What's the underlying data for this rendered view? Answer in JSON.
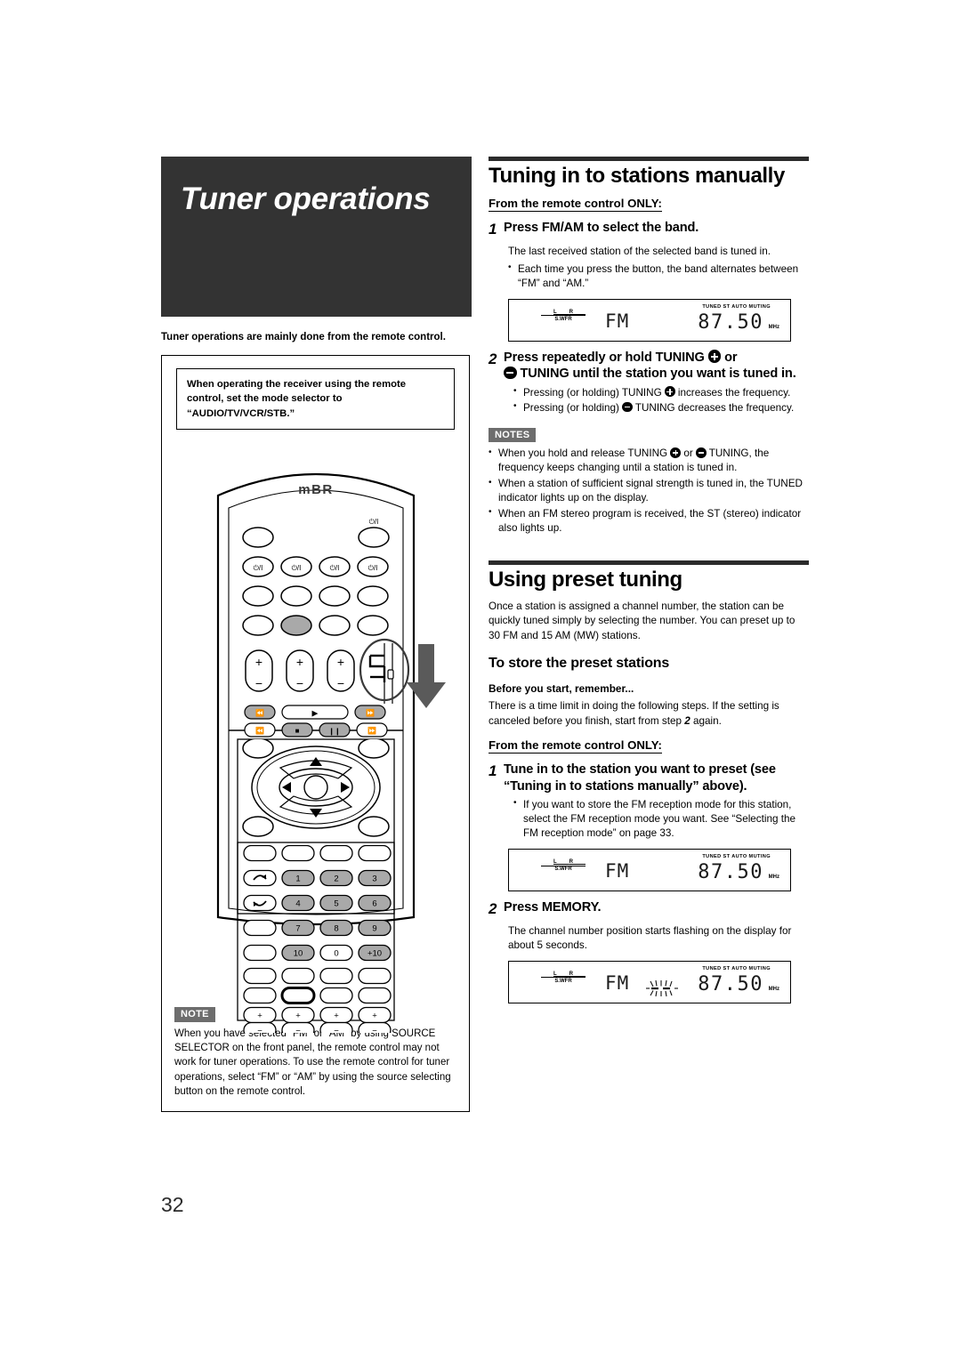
{
  "page": {
    "number": "32",
    "title": "Tuner operations",
    "intro": "Tuner operations are mainly done from the remote control.",
    "mode_note": "When operating the receiver using the remote control, set the mode selector to “AUDIO/TV/VCR/STB.”"
  },
  "remote": {
    "brand": "mBR",
    "power_symbol": "⏻/I",
    "keys": {
      "row_123": [
        "1",
        "2",
        "3"
      ],
      "row_456": [
        "4",
        "5",
        "6"
      ],
      "row_789": [
        "7",
        "8",
        "9"
      ],
      "row_10_0_plus10": [
        "10",
        "0",
        "+10"
      ]
    },
    "transport": {
      "prev": "⏮",
      "play": "▶",
      "next": "⏭",
      "rew": "⏪",
      "stop": "■",
      "pause": "❙❙",
      "ff": "⏩"
    },
    "cursor": {
      "up": "▲",
      "down": "▼",
      "left": "◀",
      "right": "▶"
    },
    "volume": {
      "plus": "+",
      "minus": "−"
    }
  },
  "note_left": {
    "label": "NOTE",
    "text": "When you have selected “FM” or “AM” by using SOURCE SELECTOR on the front panel, the remote control may not work for tuner operations. To use the remote control for tuner operations, select “FM” or “AM” by using the source selecting button on the remote control."
  },
  "section1": {
    "heading": "Tuning in to stations manually",
    "from_remote": "From the remote control ONLY:",
    "step1": {
      "num": "1",
      "title": "Press FM/AM to select the band.",
      "body": "The last received station of the selected band is tuned in.",
      "bullets": [
        "Each time you press the button, the band alternates between “FM” and “AM.”"
      ]
    },
    "step2": {
      "num": "2",
      "title_a": "Press repeatedly or hold TUNING",
      "title_b": "or",
      "title_c": "TUNING until the station you want is tuned in.",
      "bullets": [
        {
          "pre": "Pressing (or holding) TUNING",
          "icon": "plus",
          "post": "increases the frequency."
        },
        {
          "pre": "Pressing (or holding)",
          "icon": "minus",
          "post": "TUNING decreases the frequency."
        }
      ]
    },
    "notes": {
      "label": "NOTES",
      "items": [
        {
          "pre": "When you hold and release TUNING",
          "icon1": "plus",
          "mid": "or",
          "icon2": "minus",
          "post": "TUNING, the frequency keeps changing until a station is tuned in."
        },
        {
          "text": "When a station of sufficient signal strength is tuned in, the TUNED indicator lights up on the display."
        },
        {
          "text": "When an FM stereo program is received, the ST (stereo) indicator also lights up."
        }
      ]
    }
  },
  "section2": {
    "heading": "Using preset tuning",
    "intro": "Once a station is assigned a channel number, the station can be quickly tuned simply by selecting the number. You can preset up to 30 FM and 15 AM (MW) stations.",
    "sub_heading": "To store the preset stations",
    "before_label": "Before you start, remember...",
    "before_text_a": "There is a time limit in doing the following steps. If the setting is canceled before you finish, start from step",
    "before_step": "2",
    "before_text_b": "again.",
    "from_remote": "From the remote control ONLY:",
    "step1": {
      "num": "1",
      "title": "Tune in to the station you want to preset (see “Tuning in to stations manually” above).",
      "bullets": [
        "If you want to store the FM reception mode for this station, select the FM reception mode you want. See “Selecting the FM reception mode” on page 33."
      ]
    },
    "step2": {
      "num": "2",
      "title": "Press MEMORY.",
      "body": "The channel number position starts flashing on the display for about 5 seconds."
    }
  },
  "displays": [
    {
      "id": "display-band",
      "spk_left": "L",
      "spk_right": "R",
      "spk_sub": "S.WFR",
      "band": "FM",
      "indicators": "TUNED  ST  AUTO MUTING",
      "frequency": "87.50",
      "unit": "MHz",
      "flashing": false
    },
    {
      "id": "display-preset-tuned",
      "spk_left": "L",
      "spk_right": "R",
      "spk_sub": "S.WFR",
      "band": "FM",
      "indicators": "TUNED  ST  AUTO MUTING",
      "frequency": "87.50",
      "unit": "MHz",
      "flashing": false
    },
    {
      "id": "display-memory-flashing",
      "spk_left": "L",
      "spk_right": "R",
      "spk_sub": "S.WFR",
      "band": "FM",
      "indicators": "TUNED  ST  AUTO MUTING",
      "frequency": "87.50",
      "unit": "MHz",
      "flashing": true
    }
  ],
  "colors": {
    "title_bg": "#333333",
    "rule": "#2b2b2b",
    "badge_bg": "#6d6d6d",
    "key_gray": "#a9a9a9"
  }
}
